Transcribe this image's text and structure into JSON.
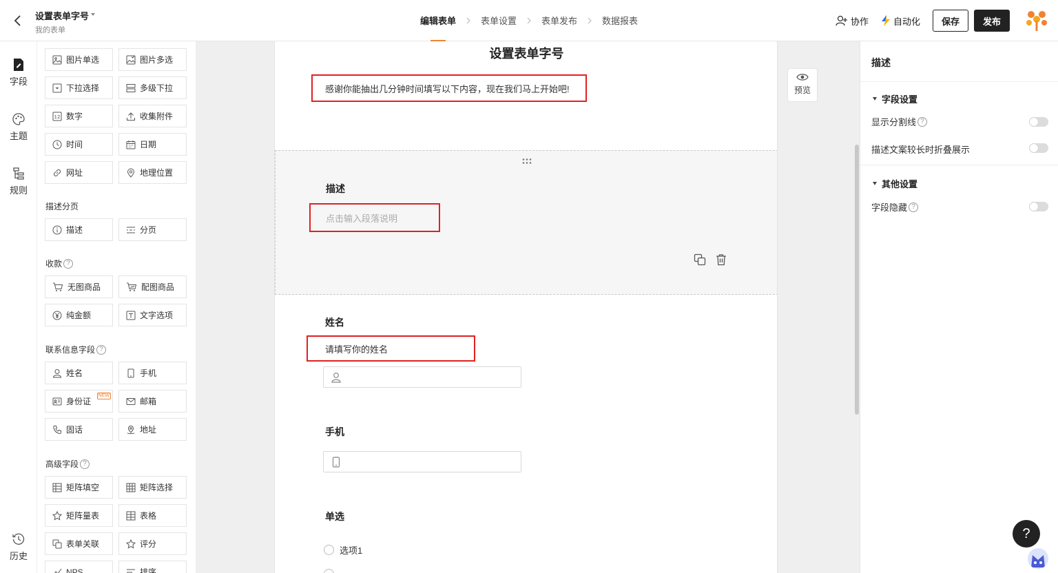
{
  "header": {
    "form_title": "设置表单字号",
    "form_subtitle": "我的表单",
    "steps": [
      "编辑表单",
      "表单设置",
      "表单发布",
      "数据报表"
    ],
    "collab_label": "协作",
    "automation_label": "自动化",
    "save_label": "保存",
    "publish_label": "发布"
  },
  "rail": {
    "fields": "字段",
    "theme": "主题",
    "rules": "规则",
    "history": "历史"
  },
  "palette": {
    "row_image": [
      "图片单选",
      "图片多选"
    ],
    "row_select": [
      "下拉选择",
      "多级下拉"
    ],
    "row_number": [
      "数字",
      "收集附件"
    ],
    "row_time": [
      "时间",
      "日期"
    ],
    "row_url": [
      "网址",
      "地理位置"
    ],
    "sec_desc": "描述分页",
    "row_desc": [
      "描述",
      "分页"
    ],
    "sec_pay": "收款",
    "row_goods": [
      "无图商品",
      "配图商品"
    ],
    "row_amount": [
      "纯金额",
      "文字选项"
    ],
    "sec_contact": "联系信息字段",
    "row_name": [
      "姓名",
      "手机"
    ],
    "row_id": [
      "身份证",
      "邮箱"
    ],
    "new_badge": "NEW",
    "row_phone": [
      "固话",
      "地址"
    ],
    "sec_adv": "高级字段",
    "row_matrix": [
      "矩阵填空",
      "矩阵选择"
    ],
    "row_scale": [
      "矩阵量表",
      "表格"
    ],
    "row_link": [
      "表单关联",
      "评分"
    ],
    "row_nps": [
      "NPS",
      "排序"
    ]
  },
  "canvas": {
    "title": "设置表单字号",
    "intro": "感谢你能抽出几分钟时间填写以下内容，现在我们马上开始吧!",
    "desc_label": "描述",
    "desc_placeholder": "点击输入段落说明",
    "name_label": "姓名",
    "name_hint": "请填写你的姓名",
    "phone_label": "手机",
    "radio_label": "单选",
    "radio_option_1": "选项1"
  },
  "preview_label": "预览",
  "right_panel": {
    "title": "描述",
    "sec_field": "字段设置",
    "show_divider": "显示分割线",
    "collapse_long": "描述文案较长时折叠展示",
    "sec_other": "其他设置",
    "hide_field": "字段隐藏"
  },
  "help_fab": "?",
  "colors": {
    "accent": "#f08232",
    "highlight_border": "#e02020",
    "dark_button": "#222222"
  }
}
